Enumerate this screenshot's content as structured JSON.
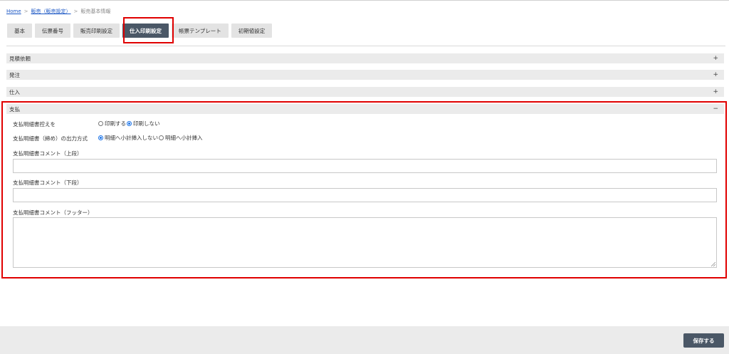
{
  "breadcrumb": {
    "home": "Home",
    "sep1": ">",
    "sales": "販売（販売設定）",
    "sep2": ">",
    "current": "販売基本情報"
  },
  "tabs": [
    {
      "label": "基本",
      "active": false
    },
    {
      "label": "伝票番号",
      "active": false
    },
    {
      "label": "販売印刷設定",
      "active": false
    },
    {
      "label": "仕入印刷設定",
      "active": true
    },
    {
      "label": "帳票テンプレート",
      "active": false
    },
    {
      "label": "初期値設定",
      "active": false
    }
  ],
  "sections": [
    {
      "title": "見積依頼",
      "toggle": "+"
    },
    {
      "title": "発注",
      "toggle": "+"
    },
    {
      "title": "仕入",
      "toggle": "+"
    },
    {
      "title": "支払",
      "toggle": "−"
    }
  ],
  "payment": {
    "print_copy_label": "支払明細書控えを",
    "print_options": [
      {
        "label": "印刷する",
        "checked": false
      },
      {
        "label": "印刷しない",
        "checked": true
      }
    ],
    "output_method_label": "支払明細書（締め）の出力方式",
    "output_options": [
      {
        "label": "明細へ小計挿入しない",
        "checked": true
      },
      {
        "label": "明細へ小計挿入",
        "checked": false
      }
    ],
    "comment_upper_label": "支払明細書コメント（上段）",
    "comment_upper_value": "",
    "comment_lower_label": "支払明細書コメント（下段）",
    "comment_lower_value": "",
    "comment_footer_label": "支払明細書コメント（フッター）",
    "comment_footer_value": ""
  },
  "footer": {
    "save_label": "保存する"
  },
  "colors": {
    "accent": "#4a5766",
    "highlight": "#e00000",
    "link": "#1a56c4",
    "radio": "#1a73e8"
  }
}
